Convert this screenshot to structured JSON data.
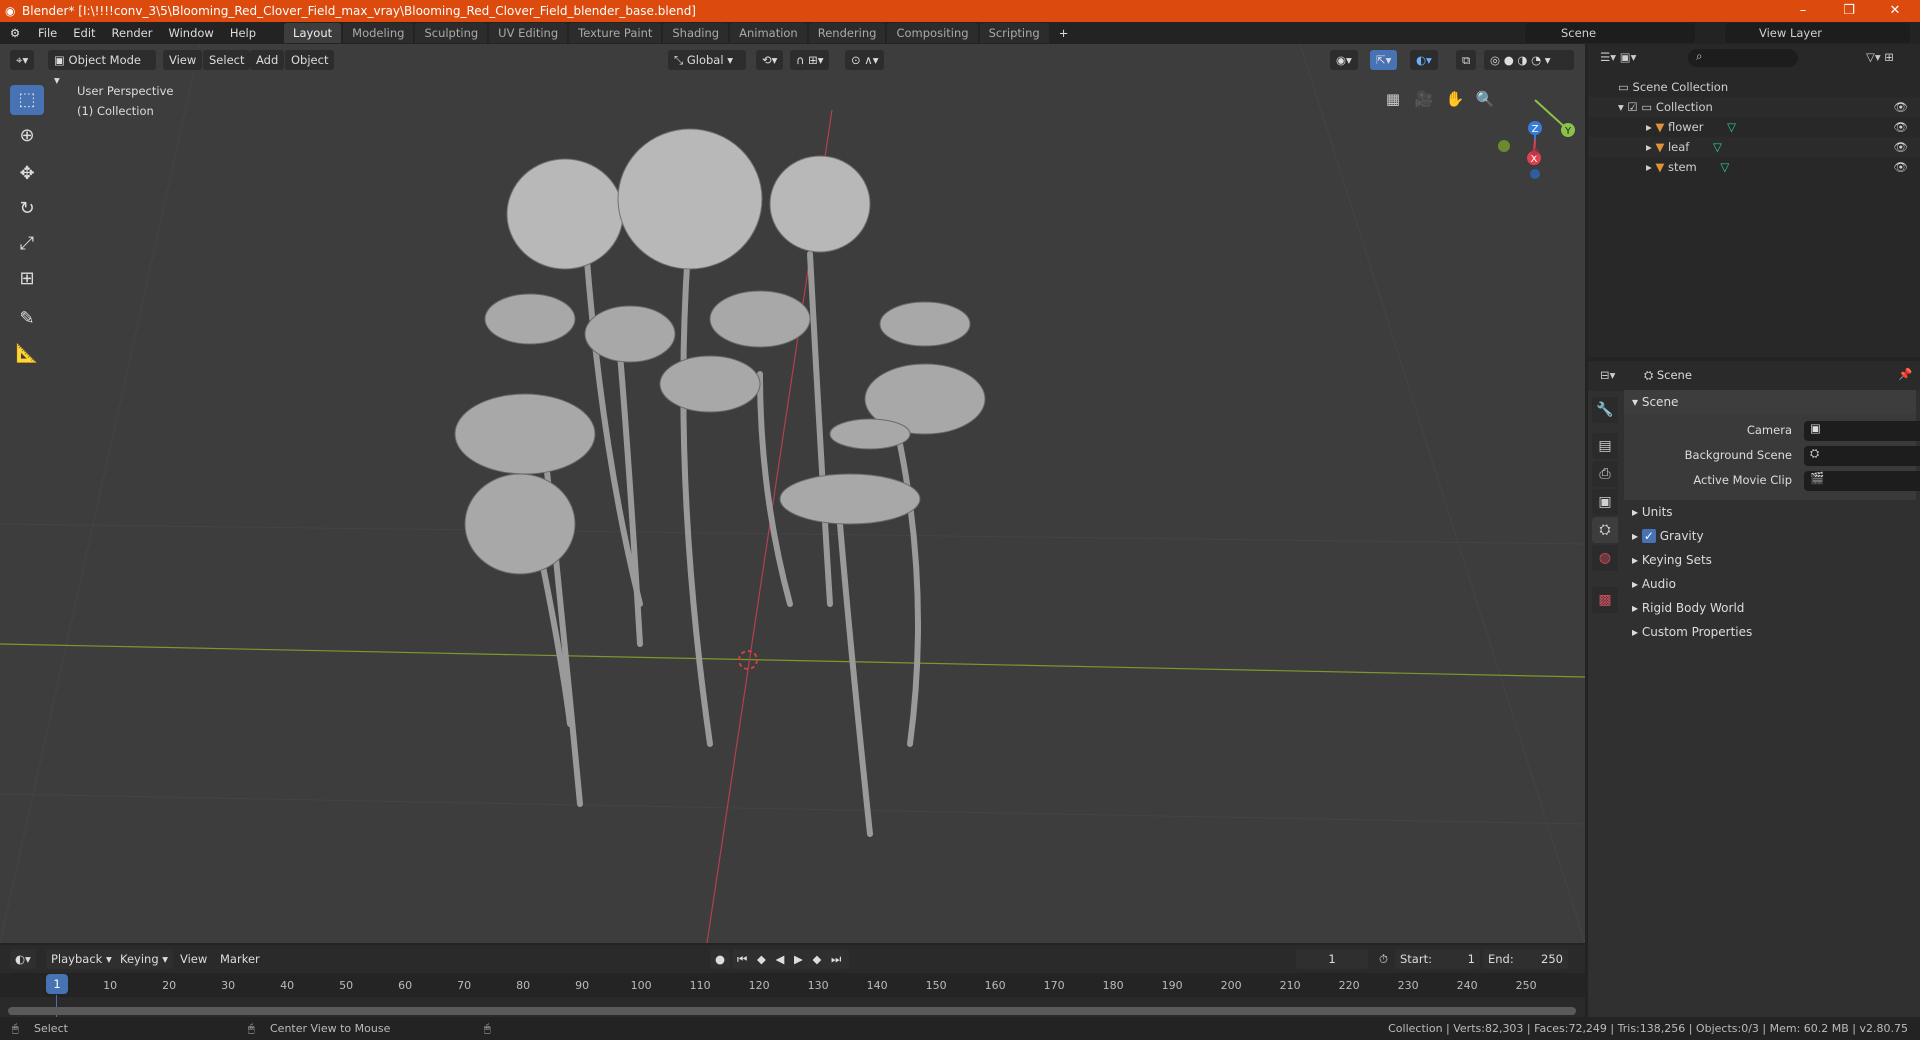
{
  "window": {
    "title": "Blender* [I:\\!!!!conv_3\\5\\Blooming_Red_Clover_Field_max_vray\\Blooming_Red_Clover_Field_blender_base.blend]",
    "minimize": "–",
    "maximize": "❐",
    "close": "✕"
  },
  "menu": [
    "File",
    "Edit",
    "Render",
    "Window",
    "Help"
  ],
  "workspaces": [
    "Layout",
    "Modeling",
    "Sculpting",
    "UV Editing",
    "Texture Paint",
    "Shading",
    "Animation",
    "Rendering",
    "Compositing",
    "Scripting"
  ],
  "active_workspace": "Layout",
  "scene_name": "Scene",
  "view_layer": "View Layer",
  "viewport": {
    "mode": "Object Mode",
    "menus": [
      "View",
      "Select",
      "Add",
      "Object"
    ],
    "orientation": "Global",
    "overlay_title": "User Perspective",
    "overlay_sub": "(1) Collection",
    "gizmo": {
      "x": "X",
      "y": "Y",
      "z": "Z"
    }
  },
  "outliner": {
    "root": "Scene Collection",
    "collection": "Collection",
    "items": [
      "flower",
      "leaf",
      "stem"
    ]
  },
  "properties": {
    "header": "Scene",
    "section": "Scene",
    "fields": [
      "Camera",
      "Background Scene",
      "Active Movie Clip"
    ],
    "panels": [
      "Units",
      "Gravity",
      "Keying Sets",
      "Audio",
      "Rigid Body World",
      "Custom Properties"
    ],
    "gravity_checked": true
  },
  "timeline": {
    "menus": [
      "Playback",
      "Keying",
      "View",
      "Marker"
    ],
    "current_frame": "1",
    "start_label": "Start:",
    "start": "1",
    "end_label": "End:",
    "end": "250",
    "ticks": [
      "10",
      "20",
      "30",
      "40",
      "50",
      "60",
      "70",
      "80",
      "90",
      "100",
      "110",
      "120",
      "130",
      "140",
      "150",
      "160",
      "170",
      "180",
      "190",
      "200",
      "210",
      "220",
      "230",
      "240",
      "250"
    ]
  },
  "status": {
    "left": "Select",
    "middle": "Center View to Mouse",
    "stats": "Collection | Verts:82,303 | Faces:72,249 | Tris:138,256 | Objects:0/3 | Mem: 60.2 MB | v2.80.75"
  },
  "colors": {
    "title_bar": "#dc4a0e",
    "accent": "#4772b3",
    "x_axis": "#e04050",
    "y_axis": "#8bc34a",
    "mesh_icon": "#e0913a",
    "data_icon": "#2bcfa0"
  }
}
